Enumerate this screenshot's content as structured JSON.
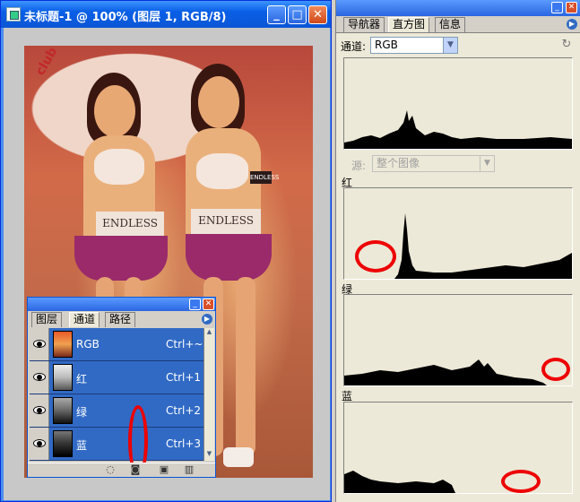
{
  "document": {
    "title": "未标题-1 @ 100% (图层 1, RGB/8)",
    "photo_text": {
      "umbrella": "club endless",
      "belt_left": "ENDLESS",
      "belt_right": "ENDLESS",
      "arm_band": "ENDLESS"
    }
  },
  "channels_panel": {
    "tabs": [
      {
        "label": "图层"
      },
      {
        "label": "通道"
      },
      {
        "label": "路径"
      }
    ],
    "active_tab": "通道",
    "channels": [
      {
        "name": "RGB",
        "shortcut": "Ctrl+~"
      },
      {
        "name": "红",
        "shortcut": "Ctrl+1"
      },
      {
        "name": "绿",
        "shortcut": "Ctrl+2"
      },
      {
        "name": "蓝",
        "shortcut": "Ctrl+3"
      }
    ]
  },
  "histogram_panel": {
    "tabs": [
      {
        "label": "导航器"
      },
      {
        "label": "直方图"
      },
      {
        "label": "信息"
      }
    ],
    "active_tab": "直方图",
    "channel_label": "通道:",
    "channel_value": "RGB",
    "source_label": "源:",
    "source_value": "整个图像",
    "sections": [
      {
        "label": "红"
      },
      {
        "label": "绿"
      },
      {
        "label": "蓝"
      }
    ]
  },
  "colors": {
    "accent": "#316ac5",
    "title_bar": "#0b56d6",
    "highlight_mark": "#e00000"
  }
}
